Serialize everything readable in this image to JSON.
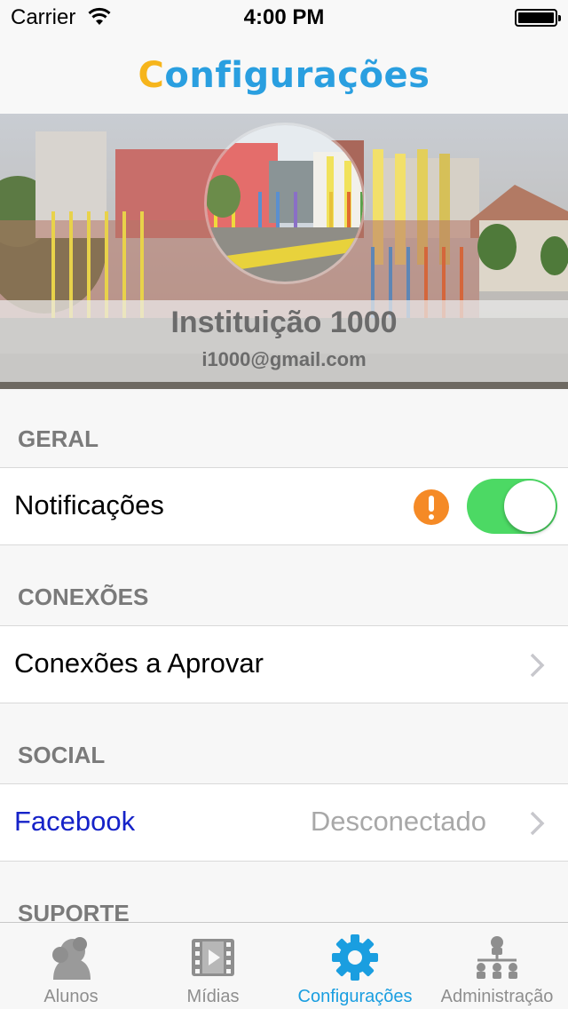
{
  "status_bar": {
    "carrier": "Carrier",
    "time": "4:00 PM"
  },
  "nav": {
    "title_first_letter": "C",
    "title_rest": "onfigurações"
  },
  "profile": {
    "name": "Instituição 1000",
    "email": "i1000@gmail.com"
  },
  "sections": {
    "geral": "GERAL",
    "conexoes": "CONEXÕES",
    "social": "SOCIAL",
    "suporte": "SUPORTE"
  },
  "rows": {
    "notificacoes": {
      "label": "Notificações",
      "enabled": true,
      "warning_icon": "exclamation-icon"
    },
    "conexoes_aprovar": {
      "label": "Conexões a Aprovar",
      "accessory": "chevron-right-icon"
    },
    "facebook": {
      "label": "Facebook",
      "detail": "Desconectado",
      "accessory": "chevron-right-icon"
    }
  },
  "tabbar": {
    "active_index": 2,
    "items": [
      {
        "label": "Alunos",
        "icon": "student-icon"
      },
      {
        "label": "Mídias",
        "icon": "film-icon"
      },
      {
        "label": "Configurações",
        "icon": "gear-icon"
      },
      {
        "label": "Administração",
        "icon": "org-chart-icon"
      }
    ]
  },
  "colors": {
    "accent": "#1a9ee0",
    "title_first_letter": "#f6b51c",
    "toggle_on": "#4cd964",
    "warning": "#f58a26",
    "link": "#1522c8"
  }
}
